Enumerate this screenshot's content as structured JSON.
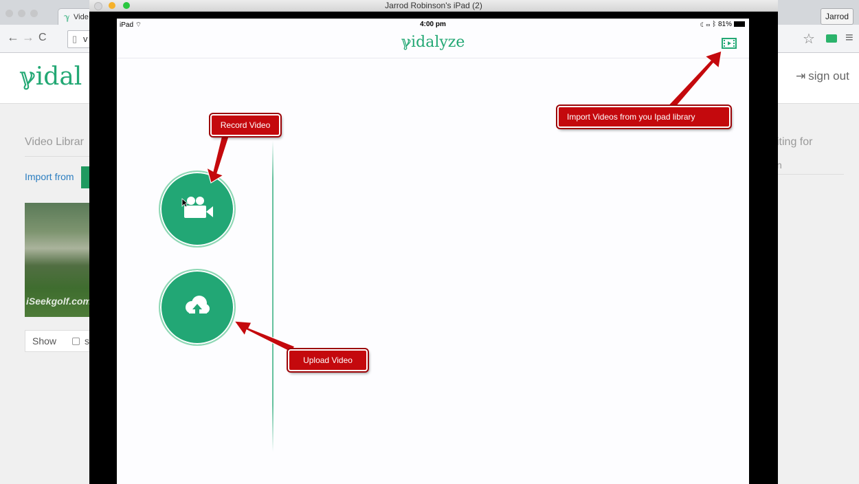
{
  "browser": {
    "tab_title": "Vide",
    "address_text": "v",
    "profile_label": "Jarrod"
  },
  "site": {
    "logo": "ℽidal",
    "signout_label": "sign out",
    "video_library_heading": "Video Librar",
    "import_from_label": "Import from",
    "thumbnail_caption": "iSeekgolf.com",
    "show_label": "Show",
    "show_checkbox_partial_label": "s",
    "right_text_1": "iting for",
    "right_text_2": "n"
  },
  "simulator": {
    "window_title": "Jarrod Robinson's iPad (2)",
    "statusbar": {
      "device": "iPad",
      "time": "4:00 pm",
      "battery": "81%"
    },
    "app_logo": "ℽidalyze"
  },
  "annotations": {
    "record": "Record Video",
    "import": "Import Videos from you Ipad library",
    "upload": "Upload Video"
  },
  "colors": {
    "brand_green": "#22a775",
    "callout_red": "#c4090d"
  },
  "icons": {
    "record": "video-camera-icon",
    "upload": "cloud-upload-icon",
    "import": "film-strip-icon"
  }
}
